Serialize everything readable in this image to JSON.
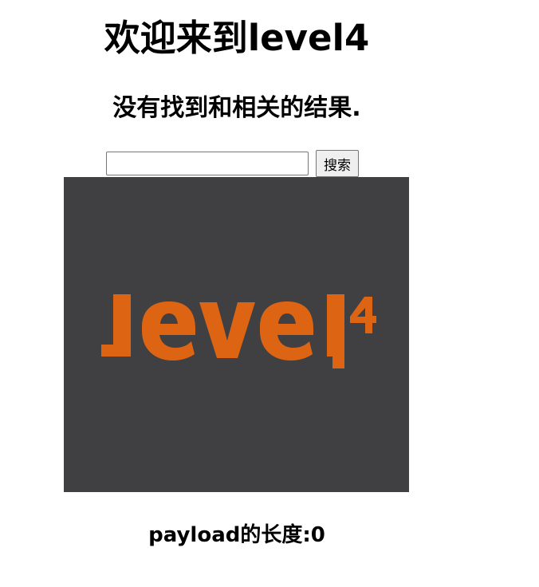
{
  "title": "欢迎来到level4",
  "result_text": "没有找到和相关的结果.",
  "search": {
    "value": "",
    "placeholder": "",
    "button_label": "搜索"
  },
  "logo": {
    "text": "level",
    "superscript": "4",
    "background_color": "#404042",
    "accent_color": "#dd6412"
  },
  "payload_length_text": "payload的长度:0"
}
